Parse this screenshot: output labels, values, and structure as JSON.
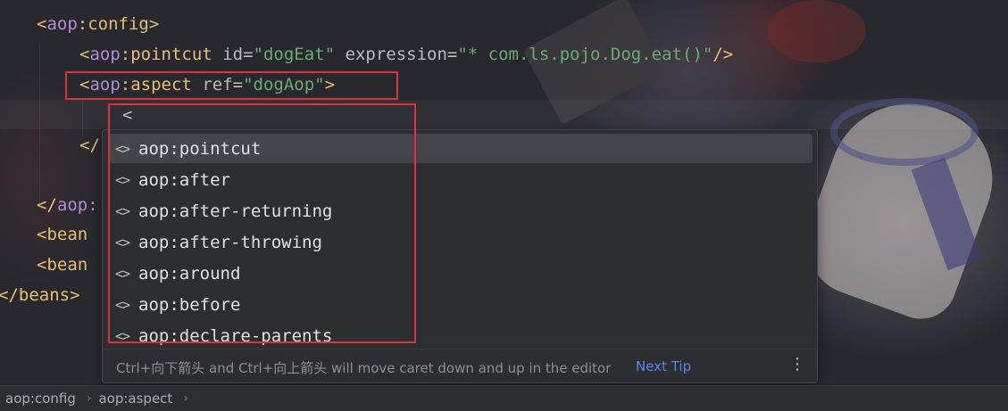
{
  "editor": {
    "lines": [
      {
        "ns": "aop",
        "tag": ":config",
        "open": "<",
        "close": ">"
      },
      {
        "ns": "aop",
        "tag": ":pointcut",
        "attr1": "id",
        "val1": "\"dogEat\"",
        "attr2": "expression",
        "val2": "\"* com.ls.pojo.Dog.eat()\"",
        "close": "/>"
      },
      {
        "ns": "aop",
        "tag": ":aspect",
        "attr1": "ref",
        "val1": "\"dogAop\"",
        "close": ">"
      },
      {
        "text": "<"
      },
      {
        "text": "</"
      },
      {
        "ns": "aop",
        "text": "</"
      },
      {
        "text": "<bean"
      },
      {
        "text": "<bean"
      },
      {
        "text": "</beans>"
      }
    ]
  },
  "completion": {
    "items": [
      {
        "icon": "xml-tag-icon",
        "label": "aop:pointcut",
        "selected": true
      },
      {
        "icon": "xml-tag-icon",
        "label": "aop:after"
      },
      {
        "icon": "xml-tag-icon",
        "label": "aop:after-returning"
      },
      {
        "icon": "xml-tag-icon",
        "label": "aop:after-throwing"
      },
      {
        "icon": "xml-tag-icon",
        "label": "aop:around"
      },
      {
        "icon": "xml-tag-icon",
        "label": "aop:before"
      },
      {
        "icon": "xml-tag-icon",
        "label": "aop:declare-parents"
      }
    ],
    "icon_glyph": "<>",
    "footer_tip": "Ctrl+向下箭头 and Ctrl+向上箭头 will move caret down and up in the editor",
    "next_tip": "Next Tip",
    "more_glyph": "⋮"
  },
  "breadcrumb": {
    "items": [
      "aop:config",
      "aop:aspect"
    ],
    "separator": "›"
  },
  "colors": {
    "tag_bracket": "#e8bf6a",
    "namespace": "#b78bd5",
    "attribute_value": "#6aab73",
    "highlight_box": "#e0303a",
    "link": "#548af7"
  }
}
